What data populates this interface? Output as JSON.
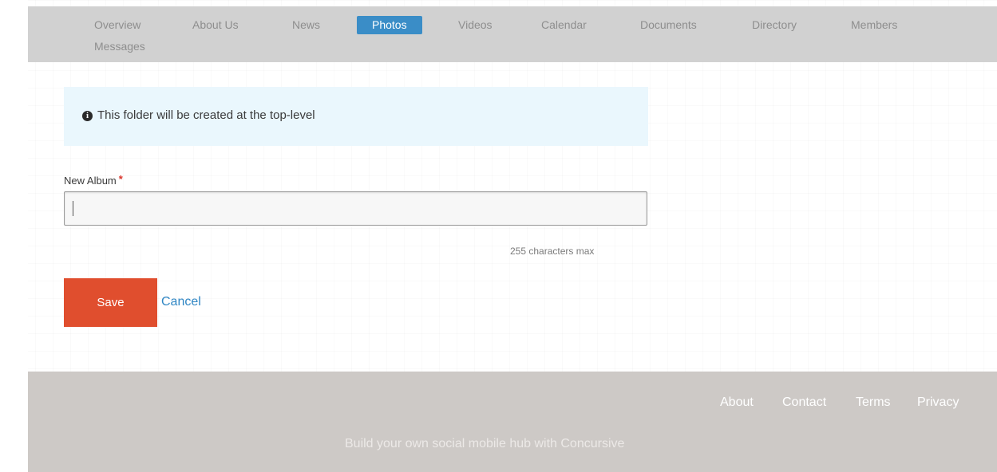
{
  "nav": {
    "items": [
      {
        "label": "Overview",
        "active": false
      },
      {
        "label": "About Us",
        "active": false
      },
      {
        "label": "News",
        "active": false
      },
      {
        "label": "Photos",
        "active": true
      },
      {
        "label": "Videos",
        "active": false
      },
      {
        "label": "Calendar",
        "active": false
      },
      {
        "label": "Documents",
        "active": false
      },
      {
        "label": "Directory",
        "active": false
      },
      {
        "label": "Members",
        "active": false
      },
      {
        "label": "Messages",
        "active": false
      }
    ]
  },
  "info": {
    "icon": "info-circle-icon",
    "text": "This folder will be created at the top-level"
  },
  "form": {
    "album_label": "New Album",
    "required_mark": "*",
    "album_value": "",
    "char_hint": "255 characters max",
    "save_label": "Save",
    "cancel_label": "Cancel"
  },
  "footer": {
    "links": [
      "About",
      "Contact",
      "Terms",
      "Privacy"
    ],
    "tagline": "Build your own social mobile hub with Concursive"
  },
  "colors": {
    "nav_active": "#3a8dc7",
    "save_button": "#e04e2e",
    "link": "#2f86c4",
    "info_bg": "#eaf7fd",
    "footer_bg": "#cdc9c6"
  }
}
